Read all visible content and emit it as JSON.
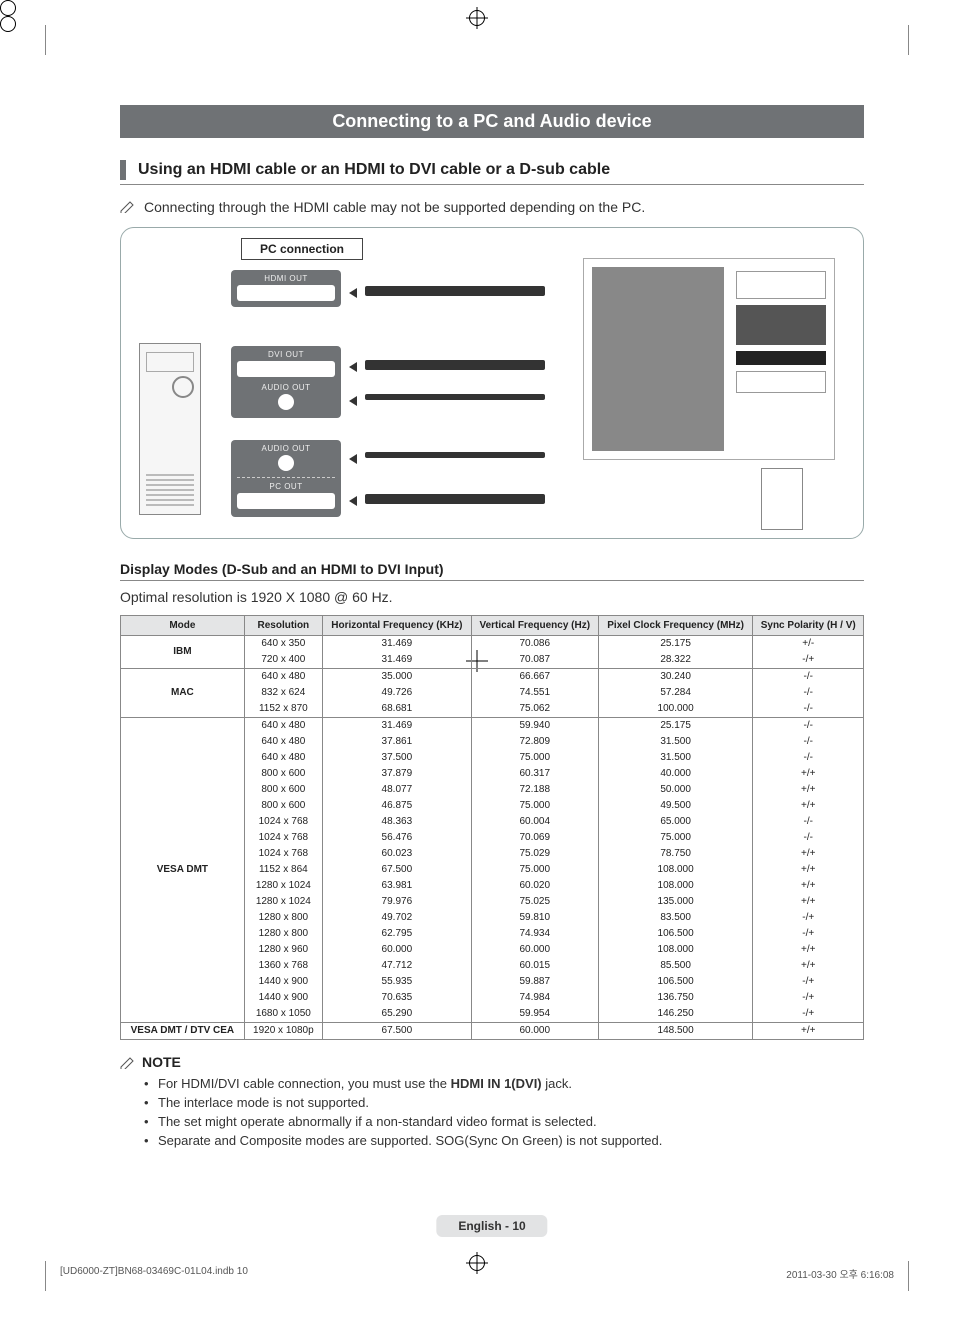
{
  "title_bar": "Connecting to a PC and Audio device",
  "section1_heading": "Using an HDMI cable or an HDMI to DVI cable or a D-sub cable",
  "section1_note": "Connecting through the HDMI cable may not be supported depending on the PC.",
  "diagram": {
    "pc_connection_label": "PC connection",
    "ports": {
      "hdmi": "HDMI OUT",
      "dvi": "DVI OUT",
      "audio1": "AUDIO OUT",
      "audio2": "AUDIO OUT",
      "pc": "PC OUT"
    }
  },
  "subhead": "Display Modes (D-Sub and an HDMI to DVI Input)",
  "optimal_line": "Optimal resolution is 1920 X 1080 @ 60 Hz.",
  "table": {
    "headers": [
      "Mode",
      "Resolution",
      "Horizontal Frequency (KHz)",
      "Vertical Frequency (Hz)",
      "Pixel Clock Frequency (MHz)",
      "Sync Polarity (H / V)"
    ],
    "groups": [
      {
        "mode": "IBM",
        "rows": [
          [
            "640 x 350",
            "31.469",
            "70.086",
            "25.175",
            "+/-"
          ],
          [
            "720 x 400",
            "31.469",
            "70.087",
            "28.322",
            "-/+"
          ]
        ]
      },
      {
        "mode": "MAC",
        "rows": [
          [
            "640 x 480",
            "35.000",
            "66.667",
            "30.240",
            "-/-"
          ],
          [
            "832 x 624",
            "49.726",
            "74.551",
            "57.284",
            "-/-"
          ],
          [
            "1152 x 870",
            "68.681",
            "75.062",
            "100.000",
            "-/-"
          ]
        ]
      },
      {
        "mode": "VESA DMT",
        "rows": [
          [
            "640 x 480",
            "31.469",
            "59.940",
            "25.175",
            "-/-"
          ],
          [
            "640 x 480",
            "37.861",
            "72.809",
            "31.500",
            "-/-"
          ],
          [
            "640 x 480",
            "37.500",
            "75.000",
            "31.500",
            "-/-"
          ],
          [
            "800 x 600",
            "37.879",
            "60.317",
            "40.000",
            "+/+"
          ],
          [
            "800 x 600",
            "48.077",
            "72.188",
            "50.000",
            "+/+"
          ],
          [
            "800 x 600",
            "46.875",
            "75.000",
            "49.500",
            "+/+"
          ],
          [
            "1024 x 768",
            "48.363",
            "60.004",
            "65.000",
            "-/-"
          ],
          [
            "1024 x 768",
            "56.476",
            "70.069",
            "75.000",
            "-/-"
          ],
          [
            "1024 x 768",
            "60.023",
            "75.029",
            "78.750",
            "+/+"
          ],
          [
            "1152 x 864",
            "67.500",
            "75.000",
            "108.000",
            "+/+"
          ],
          [
            "1280 x 1024",
            "63.981",
            "60.020",
            "108.000",
            "+/+"
          ],
          [
            "1280 x 1024",
            "79.976",
            "75.025",
            "135.000",
            "+/+"
          ],
          [
            "1280 x 800",
            "49.702",
            "59.810",
            "83.500",
            "-/+"
          ],
          [
            "1280 x 800",
            "62.795",
            "74.934",
            "106.500",
            "-/+"
          ],
          [
            "1280 x 960",
            "60.000",
            "60.000",
            "108.000",
            "+/+"
          ],
          [
            "1360 x 768",
            "47.712",
            "60.015",
            "85.500",
            "+/+"
          ],
          [
            "1440 x 900",
            "55.935",
            "59.887",
            "106.500",
            "-/+"
          ],
          [
            "1440 x 900",
            "70.635",
            "74.984",
            "136.750",
            "-/+"
          ],
          [
            "1680 x 1050",
            "65.290",
            "59.954",
            "146.250",
            "-/+"
          ]
        ]
      },
      {
        "mode": "VESA DMT / DTV CEA",
        "rows": [
          [
            "1920 x 1080p",
            "67.500",
            "60.000",
            "148.500",
            "+/+"
          ]
        ]
      }
    ]
  },
  "note_label": "NOTE",
  "notes": [
    {
      "pre": "For HDMI/DVI cable connection, you must use the ",
      "bold": "HDMI IN 1(DVI)",
      "post": " jack."
    },
    {
      "pre": "The interlace mode is not supported.",
      "bold": "",
      "post": ""
    },
    {
      "pre": "The set might operate abnormally if a non-standard video format is selected.",
      "bold": "",
      "post": ""
    },
    {
      "pre": "Separate and Composite modes are supported. SOG(Sync On Green) is not supported.",
      "bold": "",
      "post": ""
    }
  ],
  "page_label": "English - 10",
  "footer_left": "[UD6000-ZT]BN68-03469C-01L04.indb   10",
  "footer_right": "2011-03-30   오후 6:16:08",
  "chart_data": {
    "type": "table",
    "title": "Display Modes (D-Sub and an HDMI to DVI Input)",
    "columns": [
      "Mode",
      "Resolution",
      "Horizontal Frequency (KHz)",
      "Vertical Frequency (Hz)",
      "Pixel Clock Frequency (MHz)",
      "Sync Polarity (H / V)"
    ],
    "rows": [
      [
        "IBM",
        "640 x 350",
        31.469,
        70.086,
        25.175,
        "+/-"
      ],
      [
        "IBM",
        "720 x 400",
        31.469,
        70.087,
        28.322,
        "-/+"
      ],
      [
        "MAC",
        "640 x 480",
        35.0,
        66.667,
        30.24,
        "-/-"
      ],
      [
        "MAC",
        "832 x 624",
        49.726,
        74.551,
        57.284,
        "-/-"
      ],
      [
        "MAC",
        "1152 x 870",
        68.681,
        75.062,
        100.0,
        "-/-"
      ],
      [
        "VESA DMT",
        "640 x 480",
        31.469,
        59.94,
        25.175,
        "-/-"
      ],
      [
        "VESA DMT",
        "640 x 480",
        37.861,
        72.809,
        31.5,
        "-/-"
      ],
      [
        "VESA DMT",
        "640 x 480",
        37.5,
        75.0,
        31.5,
        "-/-"
      ],
      [
        "VESA DMT",
        "800 x 600",
        37.879,
        60.317,
        40.0,
        "+/+"
      ],
      [
        "VESA DMT",
        "800 x 600",
        48.077,
        72.188,
        50.0,
        "+/+"
      ],
      [
        "VESA DMT",
        "800 x 600",
        46.875,
        75.0,
        49.5,
        "+/+"
      ],
      [
        "VESA DMT",
        "1024 x 768",
        48.363,
        60.004,
        65.0,
        "-/-"
      ],
      [
        "VESA DMT",
        "1024 x 768",
        56.476,
        70.069,
        75.0,
        "-/-"
      ],
      [
        "VESA DMT",
        "1024 x 768",
        60.023,
        75.029,
        78.75,
        "+/+"
      ],
      [
        "VESA DMT",
        "1152 x 864",
        67.5,
        75.0,
        108.0,
        "+/+"
      ],
      [
        "VESA DMT",
        "1280 x 1024",
        63.981,
        60.02,
        108.0,
        "+/+"
      ],
      [
        "VESA DMT",
        "1280 x 1024",
        79.976,
        75.025,
        135.0,
        "+/+"
      ],
      [
        "VESA DMT",
        "1280 x 800",
        49.702,
        59.81,
        83.5,
        "-/+"
      ],
      [
        "VESA DMT",
        "1280 x 800",
        62.795,
        74.934,
        106.5,
        "-/+"
      ],
      [
        "VESA DMT",
        "1280 x 960",
        60.0,
        60.0,
        108.0,
        "+/+"
      ],
      [
        "VESA DMT",
        "1360 x 768",
        47.712,
        60.015,
        85.5,
        "+/+"
      ],
      [
        "VESA DMT",
        "1440 x 900",
        55.935,
        59.887,
        106.5,
        "-/+"
      ],
      [
        "VESA DMT",
        "1440 x 900",
        70.635,
        74.984,
        136.75,
        "-/+"
      ],
      [
        "VESA DMT",
        "1680 x 1050",
        65.29,
        59.954,
        146.25,
        "-/+"
      ],
      [
        "VESA DMT / DTV CEA",
        "1920 x 1080p",
        67.5,
        60.0,
        148.5,
        "+/+"
      ]
    ]
  }
}
